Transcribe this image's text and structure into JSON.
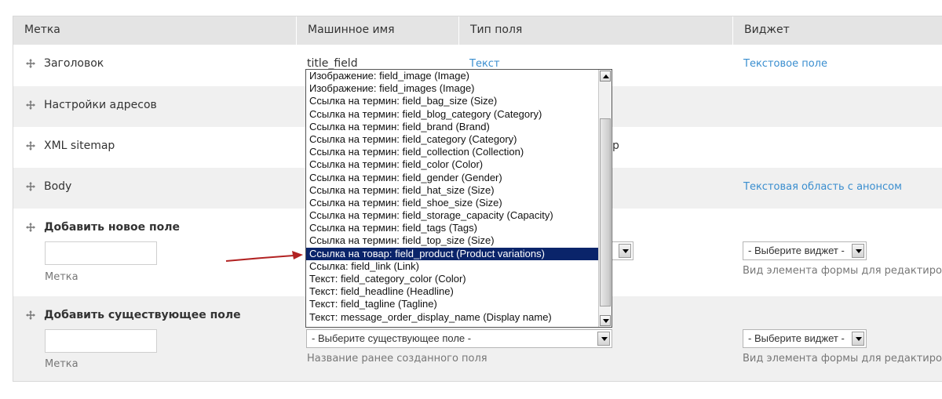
{
  "headers": {
    "label": "Метка",
    "machine_name": "Машинное имя",
    "field_type": "Тип поля",
    "widget": "Виджет"
  },
  "rows": {
    "title": {
      "label": "Заголовок",
      "machine": "title_field",
      "type": "Текст",
      "widget": "Текстовое поле"
    },
    "path": {
      "label": "Настройки адресов"
    },
    "sitemap": {
      "label": "XML sitemap",
      "peek": "p"
    },
    "body": {
      "label": "Body",
      "widget": "Текстовая область с анонсом"
    }
  },
  "add_new": {
    "label": "Добавить новое поле",
    "input_value": "",
    "input_desc": "Метка",
    "widget_select": "- Выберите виджет -",
    "widget_desc": "Вид элемента формы для редактирования"
  },
  "add_existing": {
    "label": "Добавить существующее поле",
    "input_value": "",
    "input_desc": "Метка",
    "field_select": "- Выберите существующее поле -",
    "field_desc": "Название ранее созданного поля",
    "widget_select": "- Выберите виджет -",
    "widget_desc": "Вид элемента формы для редактирования"
  },
  "dropdown": {
    "items": [
      "Изображение: field_image (Image)",
      "Изображение: field_images (Image)",
      "Ссылка на термин: field_bag_size (Size)",
      "Ссылка на термин: field_blog_category (Category)",
      "Ссылка на термин: field_brand (Brand)",
      "Ссылка на термин: field_category (Category)",
      "Ссылка на термин: field_collection (Collection)",
      "Ссылка на термин: field_color (Color)",
      "Ссылка на термин: field_gender (Gender)",
      "Ссылка на термин: field_hat_size (Size)",
      "Ссылка на термин: field_shoe_size (Size)",
      "Ссылка на термин: field_storage_capacity (Capacity)",
      "Ссылка на термин: field_tags (Tags)",
      "Ссылка на термин: field_top_size (Size)",
      "Ссылка на товар: field_product (Product variations)",
      "Ссылка: field_link (Link)",
      "Текст: field_category_color (Color)",
      "Текст: field_headline (Headline)",
      "Текст: field_tagline (Tagline)",
      "Текст: message_order_display_name (Display name)"
    ],
    "selected_index": 14
  },
  "colors": {
    "header_bg": "#e4e4e4",
    "row_alt_bg": "#f0f0f0",
    "link": "#3a8ecf",
    "selection_bg": "#0a246a",
    "arrow": "#b22222"
  }
}
